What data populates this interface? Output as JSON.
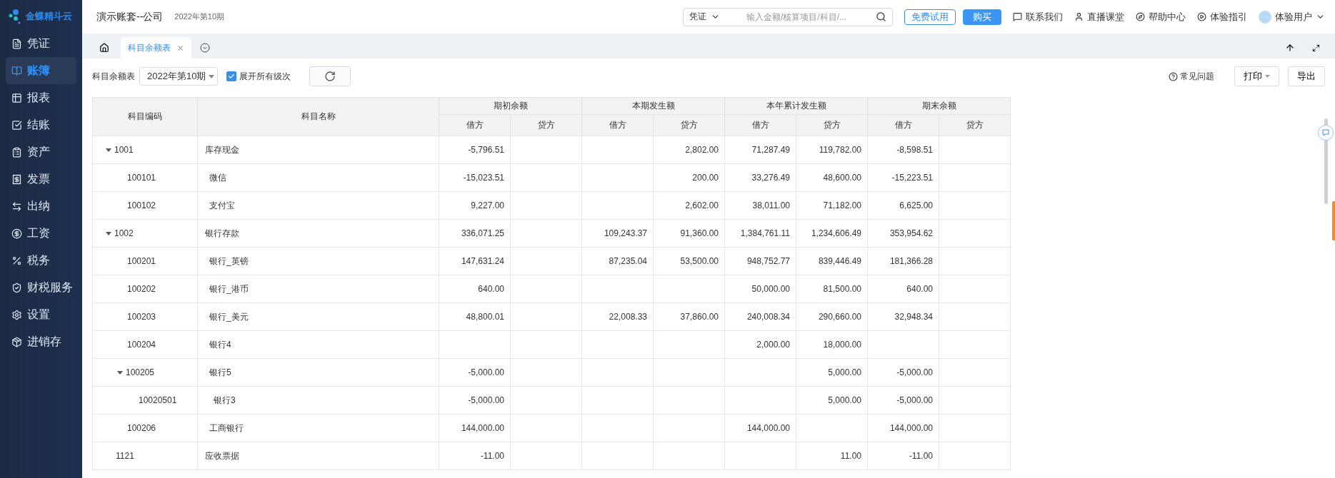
{
  "sidebar": {
    "logo": "金蝶精斗云",
    "items": [
      {
        "label": "凭证",
        "kind": "voucher",
        "selected": false
      },
      {
        "label": "账簿",
        "kind": "book",
        "selected": true
      },
      {
        "label": "报表",
        "kind": "report",
        "selected": false
      },
      {
        "label": "结账",
        "kind": "close",
        "selected": false
      },
      {
        "label": "资产",
        "kind": "asset",
        "selected": false
      },
      {
        "label": "发票",
        "kind": "invoice",
        "selected": false
      },
      {
        "label": "出纳",
        "kind": "cashier",
        "selected": false
      },
      {
        "label": "工资",
        "kind": "salary",
        "selected": false
      },
      {
        "label": "税务",
        "kind": "tax",
        "selected": false
      },
      {
        "label": "财税服务",
        "kind": "service",
        "selected": false
      },
      {
        "label": "设置",
        "kind": "settings",
        "selected": false
      },
      {
        "label": "进销存",
        "kind": "inventory",
        "selected": false
      }
    ]
  },
  "header": {
    "title": "演示账套--公司",
    "period": "2022年第10期",
    "search": {
      "scope": "凭证",
      "placeholder": "输入金额/核算项目/科目/..."
    },
    "trial_button": "免费试用",
    "buy_button": "购买",
    "links": [
      {
        "label": "联系我们",
        "kind": "contact"
      },
      {
        "label": "直播课堂",
        "kind": "live"
      },
      {
        "label": "帮助中心",
        "kind": "help"
      },
      {
        "label": "体验指引",
        "kind": "guide"
      }
    ],
    "user": "体验用户"
  },
  "tabs": [
    {
      "label": "科目余额表",
      "selected": true
    }
  ],
  "toolbar": {
    "label": "科目余额表",
    "period": "2022年第10期",
    "expand_all": {
      "label": "展开所有级次",
      "checked": true
    },
    "faq": "常见问题",
    "print": "打印",
    "export": "导出"
  },
  "table": {
    "columns": [
      "科目编码",
      "科目名称"
    ],
    "groups": [
      {
        "label": "期初余额",
        "sub": [
          "借方",
          "贷方"
        ]
      },
      {
        "label": "本期发生额",
        "sub": [
          "借方",
          "贷方"
        ]
      },
      {
        "label": "本年累计发生额",
        "sub": [
          "借方",
          "贷方"
        ]
      },
      {
        "label": "期末余额",
        "sub": [
          "借方",
          "贷方"
        ]
      }
    ],
    "rows": [
      {
        "code": "1001",
        "name": "库存现金",
        "expanded": true,
        "values": {
          "begin_debit": "-5,796.51",
          "period_credit": "2,802.00",
          "ytd_debit": "71,287.49",
          "ytd_credit": "119,782.00",
          "end_debit": "-8,598.51"
        },
        "children": [
          {
            "code": "100101",
            "name": "微信",
            "values": {
              "begin_debit": "-15,023.51",
              "period_credit": "200.00",
              "ytd_debit": "33,276.49",
              "ytd_credit": "48,600.00",
              "end_debit": "-15,223.51"
            }
          },
          {
            "code": "100102",
            "name": "支付宝",
            "values": {
              "begin_debit": "9,227.00",
              "period_credit": "2,602.00",
              "ytd_debit": "38,011.00",
              "ytd_credit": "71,182.00",
              "end_debit": "6,625.00"
            }
          }
        ]
      },
      {
        "code": "1002",
        "name": "银行存款",
        "expanded": true,
        "values": {
          "begin_debit": "336,071.25",
          "period_debit": "109,243.37",
          "period_credit": "91,360.00",
          "ytd_debit": "1,384,761.11",
          "ytd_credit": "1,234,606.49",
          "end_debit": "353,954.62"
        },
        "children": [
          {
            "code": "100201",
            "name": "银行_英镑",
            "values": {
              "begin_debit": "147,631.24",
              "period_debit": "87,235.04",
              "period_credit": "53,500.00",
              "ytd_debit": "948,752.77",
              "ytd_credit": "839,446.49",
              "end_debit": "181,366.28"
            }
          },
          {
            "code": "100202",
            "name": "银行_港币",
            "values": {
              "begin_debit": "640.00",
              "ytd_debit": "50,000.00",
              "ytd_credit": "81,500.00",
              "end_debit": "640.00"
            }
          },
          {
            "code": "100203",
            "name": "银行_美元",
            "values": {
              "begin_debit": "48,800.01",
              "period_debit": "22,008.33",
              "period_credit": "37,860.00",
              "ytd_debit": "240,008.34",
              "ytd_credit": "290,660.00",
              "end_debit": "32,948.34"
            }
          },
          {
            "code": "100204",
            "name": "银行4",
            "values": {
              "ytd_debit": "2,000.00",
              "ytd_credit": "18,000.00"
            }
          },
          {
            "code": "100205",
            "name": "银行5",
            "expanded": true,
            "values": {
              "begin_debit": "-5,000.00",
              "ytd_credit": "5,000.00",
              "end_debit": "-5,000.00"
            },
            "children": [
              {
                "code": "10020501",
                "name": "银行3",
                "values": {
                  "begin_debit": "-5,000.00",
                  "ytd_credit": "5,000.00",
                  "end_debit": "-5,000.00"
                }
              }
            ]
          },
          {
            "code": "100206",
            "name": "工商银行",
            "values": {
              "begin_debit": "144,000.00",
              "ytd_debit": "144,000.00",
              "end_debit": "144,000.00"
            }
          }
        ]
      },
      {
        "code": "1121",
        "name": "应收票据",
        "values": {
          "begin_debit": "-11.00",
          "ytd_credit": "11.00",
          "end_debit": "-11.00"
        }
      }
    ]
  }
}
